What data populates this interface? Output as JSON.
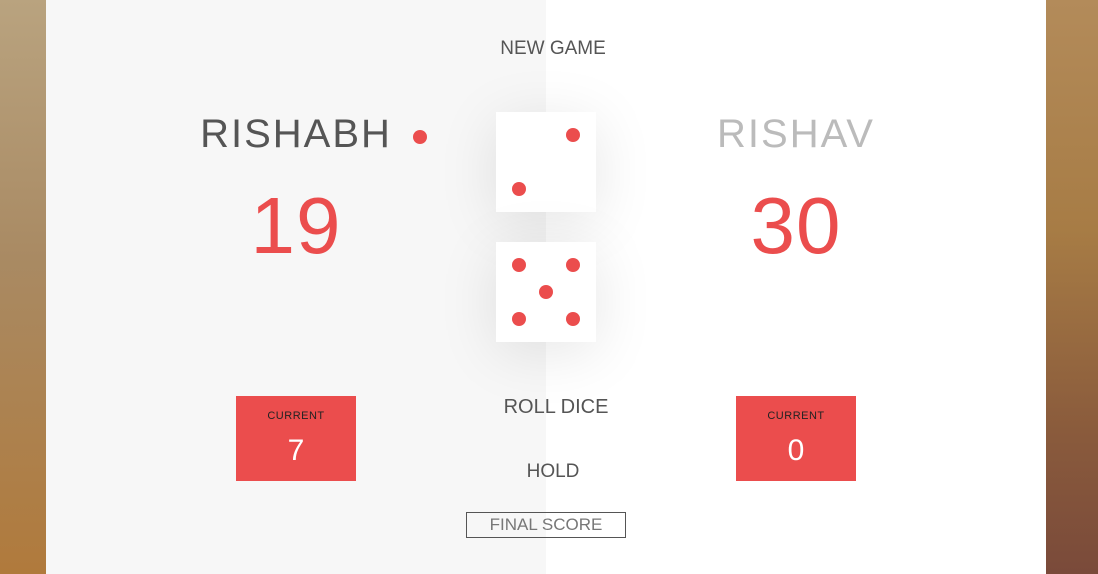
{
  "buttons": {
    "new_game": "NEW GAME",
    "roll_dice": "ROLL DICE",
    "hold": "HOLD"
  },
  "final_score": {
    "placeholder": "FINAL SCORE",
    "value": ""
  },
  "players": [
    {
      "name": "RISHABH",
      "score": "19",
      "current_label": "CURRENT",
      "current_score": "7",
      "active": true
    },
    {
      "name": "RISHAV",
      "score": "30",
      "current_label": "CURRENT",
      "current_score": "0",
      "active": false
    }
  ],
  "dice": [
    {
      "value": 2
    },
    {
      "value": 5
    }
  ],
  "colors": {
    "accent": "#eb4d4d",
    "panel_active": "#f7f7f7",
    "panel_inactive": "#ffffff"
  }
}
